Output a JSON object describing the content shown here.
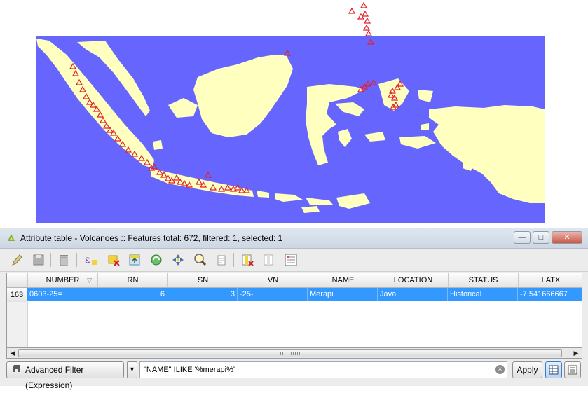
{
  "map": {
    "water_color": "#6666ff",
    "land_color": "#ffffc0",
    "marker_color": "#e0202c",
    "marker_shape": "triangle",
    "layer_name": "Volcanoes"
  },
  "window": {
    "title": "Attribute table - Volcanoes :: Features total: 672, filtered: 1, selected: 1",
    "app_icon": "qgis-logo-icon",
    "controls": {
      "minimize": "minimize-icon",
      "maximize": "maximize-icon",
      "close": "close-icon"
    }
  },
  "toolbar": {
    "help_label": "?",
    "buttons": [
      {
        "name": "toggle-editing-icon"
      },
      {
        "name": "save-edits-icon"
      },
      {
        "name": "delete-selected-icon"
      },
      {
        "name": "select-by-expression-icon"
      },
      {
        "name": "unselect-all-icon"
      },
      {
        "name": "move-selection-to-top-icon"
      },
      {
        "name": "invert-selection-icon"
      },
      {
        "name": "pan-to-selected-icon"
      },
      {
        "name": "zoom-to-selected-icon"
      },
      {
        "name": "copy-selected-rows-icon"
      },
      {
        "name": "delete-column-icon"
      },
      {
        "name": "new-column-icon"
      },
      {
        "name": "field-calculator-icon"
      }
    ]
  },
  "table": {
    "columns": [
      "NUMBER",
      "RN",
      "SN",
      "VN",
      "NAME",
      "LOCATION",
      "STATUS",
      "LATX"
    ],
    "rows": [
      {
        "row_number": "163",
        "cells": [
          "0603-25=",
          "6",
          "3",
          "-25-",
          "Merapi",
          "Java",
          "Historical",
          "-7.541666667"
        ]
      }
    ],
    "selected_color": "#3399ff"
  },
  "filter": {
    "mode_label": "Advanced Filter (Expression)",
    "expression": "\"NAME\" ILIKE '%merapi%'",
    "apply_label": "Apply"
  }
}
